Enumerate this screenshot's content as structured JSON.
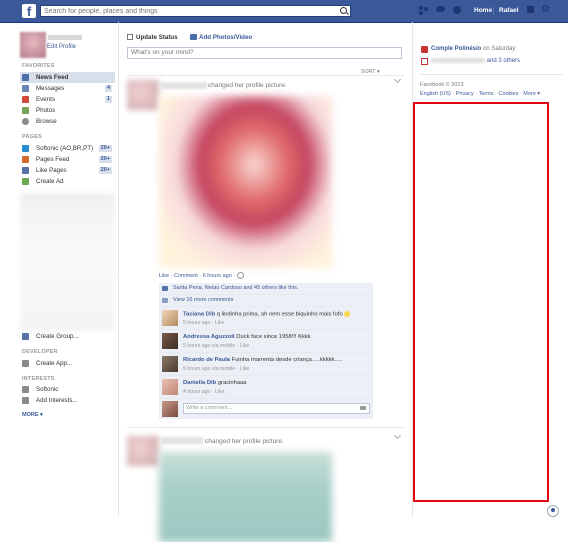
{
  "topbar": {
    "logo": "f",
    "search_placeholder": "Search for people, places and things",
    "home": "Home",
    "user": "Rafael"
  },
  "left": {
    "edit_profile": "Edit Profile",
    "favorites_head": "FAVORITES",
    "favorites": [
      {
        "label": "News Feed",
        "count": ""
      },
      {
        "label": "Messages",
        "count": "4"
      },
      {
        "label": "Events",
        "count": "1"
      },
      {
        "label": "Photos",
        "count": ""
      },
      {
        "label": "Browse",
        "count": ""
      }
    ],
    "pages_head": "PAGES",
    "pages": [
      {
        "label": "Softonic (AO,BR,PT)",
        "count": "20+"
      },
      {
        "label": "Pages Feed",
        "count": "20+"
      },
      {
        "label": "Like Pages",
        "count": "20+"
      },
      {
        "label": "Create Ad",
        "count": ""
      }
    ],
    "create_group": "Create Group...",
    "developer_head": "DEVELOPER",
    "create_app": "Create App...",
    "interests_head": "INTERESTS",
    "softonic": "Softonic",
    "add_interests": "Add Interests...",
    "more": "MORE ▾"
  },
  "composer": {
    "update_status": "Update Status",
    "add_photo": "Add Photos/Video",
    "placeholder": "What's on your mind?",
    "sort": "SORT ▾"
  },
  "stories": [
    {
      "action": "changed her profile picture.",
      "meta": "Like · Comment · 6 hours ago · ",
      "likes": "Sarita Pena, Netao Cardoso and 45 others like this.",
      "view_more": "View 16 more comments",
      "comments": [
        {
          "name": "Taciana Dib",
          "text": "q lindinha prima, ah nem esse biquinho mais fofo",
          "time": "5 hours ago · Like",
          "emoji": true
        },
        {
          "name": "Andressa Aguzzoli",
          "text": "Duck face since 1958!!! Kkkk",
          "time": "5 hours ago via mobile · Like",
          "emoji": false
        },
        {
          "name": "Ricardo de Paula",
          "text": "Fuinha marrenta desde criança.....kkkkk.....",
          "time": "5 hours ago via mobile · Like",
          "emoji": false
        },
        {
          "name": "Daniella Dib",
          "text": "gracinhaaa",
          "time": "4 hours ago · Like",
          "emoji": false
        }
      ],
      "write_comment": "Write a comment..."
    },
    {
      "action": "changed her profile picture."
    }
  ],
  "right": {
    "event1_link": "Comple Polinésio",
    "event1_rest": " on Saturday",
    "event2_rest": "and 3 others",
    "copyright": "Facebook © 2013",
    "footer": [
      {
        "label": "English (US)"
      },
      {
        "label": "Privacy"
      },
      {
        "label": "Terms"
      },
      {
        "label": "Cookies"
      },
      {
        "label": "More ▾"
      }
    ]
  },
  "colors": {
    "brand": "#3b5998",
    "highlight": "#e30613"
  }
}
